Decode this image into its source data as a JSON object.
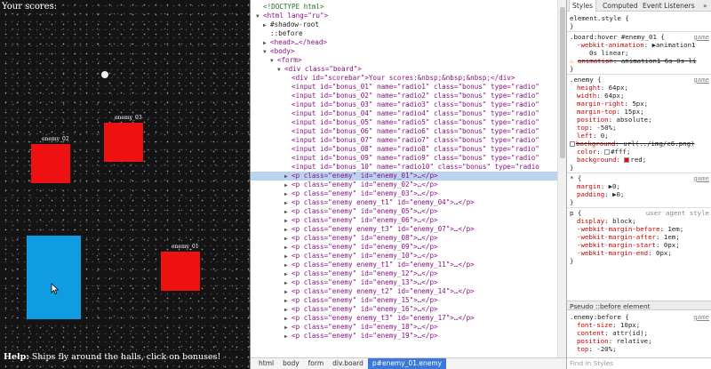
{
  "game": {
    "scorebar": "Your scores:",
    "help_label": "Help:",
    "help_text": " Ships fly around the halls, click on bonuses!",
    "enemies": [
      {
        "id": "enemy_03",
        "label": "enemy_03",
        "color": "#ee1111"
      },
      {
        "id": "enemy_02",
        "label": "enemy_02",
        "color": "#ee1111"
      },
      {
        "id": "enemy_01",
        "label": "enemy_01",
        "color": "#ee1111"
      }
    ],
    "player_color": "#109ce0"
  },
  "elements": {
    "lines": [
      {
        "indent": 0,
        "arrow": "",
        "text": "<!DOCTYPE html>",
        "kind": "comment"
      },
      {
        "indent": 0,
        "arrow": "▼",
        "text": "<html lang=\"ru\">",
        "kind": "tag"
      },
      {
        "indent": 1,
        "arrow": "▶",
        "text": "#shadow-root",
        "kind": "text"
      },
      {
        "indent": 1,
        "arrow": "",
        "text": "::before",
        "kind": "pseudo"
      },
      {
        "indent": 1,
        "arrow": "▶",
        "text": "<head>…</head>",
        "kind": "tag"
      },
      {
        "indent": 1,
        "arrow": "▼",
        "text": "<body>",
        "kind": "tag"
      },
      {
        "indent": 2,
        "arrow": "▼",
        "text": "<form>",
        "kind": "tag"
      },
      {
        "indent": 3,
        "arrow": "▼",
        "text": "<div class=\"board\">",
        "kind": "tag"
      },
      {
        "indent": 4,
        "arrow": "",
        "text": "<div id=\"scorebar\">Your scores:&nbsp;&nbsp;&nbsp;</div>",
        "kind": "tag"
      },
      {
        "indent": 4,
        "arrow": "",
        "text": "<input id=\"bonus_01\" name=\"radio1\" class=\"bonus\" type=\"radio\"",
        "kind": "tag"
      },
      {
        "indent": 4,
        "arrow": "",
        "text": "<input id=\"bonus_02\" name=\"radio2\" class=\"bonus\" type=\"radio\"",
        "kind": "tag"
      },
      {
        "indent": 4,
        "arrow": "",
        "text": "<input id=\"bonus_03\" name=\"radio3\" class=\"bonus\" type=\"radio\"",
        "kind": "tag"
      },
      {
        "indent": 4,
        "arrow": "",
        "text": "<input id=\"bonus_04\" name=\"radio4\" class=\"bonus\" type=\"radio\"",
        "kind": "tag"
      },
      {
        "indent": 4,
        "arrow": "",
        "text": "<input id=\"bonus_05\" name=\"radio5\" class=\"bonus\" type=\"radio\"",
        "kind": "tag"
      },
      {
        "indent": 4,
        "arrow": "",
        "text": "<input id=\"bonus_06\" name=\"radio6\" class=\"bonus\" type=\"radio\"",
        "kind": "tag"
      },
      {
        "indent": 4,
        "arrow": "",
        "text": "<input id=\"bonus_07\" name=\"radio7\" class=\"bonus\" type=\"radio\"",
        "kind": "tag"
      },
      {
        "indent": 4,
        "arrow": "",
        "text": "<input id=\"bonus_08\" name=\"radio8\" class=\"bonus\" type=\"radio\"",
        "kind": "tag"
      },
      {
        "indent": 4,
        "arrow": "",
        "text": "<input id=\"bonus_09\" name=\"radio9\" class=\"bonus\" type=\"radio\"",
        "kind": "tag"
      },
      {
        "indent": 4,
        "arrow": "",
        "text": "<input id=\"bonus_10\" name=\"radio10\" class=\"bonus\" type=\"radio",
        "kind": "tag"
      },
      {
        "indent": 4,
        "arrow": "▶",
        "text": "<p class=\"enemy\" id=\"enemy_01\">…</p>",
        "kind": "tag",
        "selected": true
      },
      {
        "indent": 4,
        "arrow": "▶",
        "text": "<p class=\"enemy\" id=\"enemy_02\">…</p>",
        "kind": "tag"
      },
      {
        "indent": 4,
        "arrow": "▶",
        "text": "<p class=\"enemy\" id=\"enemy_03\">…</p>",
        "kind": "tag"
      },
      {
        "indent": 4,
        "arrow": "▶",
        "text": "<p class=\"enemy enemy_t1\" id=\"enemy_04\">…</p>",
        "kind": "tag"
      },
      {
        "indent": 4,
        "arrow": "▶",
        "text": "<p class=\"enemy\" id=\"enemy_05\">…</p>",
        "kind": "tag"
      },
      {
        "indent": 4,
        "arrow": "▶",
        "text": "<p class=\"enemy\" id=\"enemy_06\">…</p>",
        "kind": "tag"
      },
      {
        "indent": 4,
        "arrow": "▶",
        "text": "<p class=\"enemy enemy_t3\" id=\"enemy_07\">…</p>",
        "kind": "tag"
      },
      {
        "indent": 4,
        "arrow": "▶",
        "text": "<p class=\"enemy\" id=\"enemy_08\">…</p>",
        "kind": "tag"
      },
      {
        "indent": 4,
        "arrow": "▶",
        "text": "<p class=\"enemy\" id=\"enemy_09\">…</p>",
        "kind": "tag"
      },
      {
        "indent": 4,
        "arrow": "▶",
        "text": "<p class=\"enemy\" id=\"enemy_10\">…</p>",
        "kind": "tag"
      },
      {
        "indent": 4,
        "arrow": "▶",
        "text": "<p class=\"enemy enemy_t1\" id=\"enemy_11\">…</p>",
        "kind": "tag"
      },
      {
        "indent": 4,
        "arrow": "▶",
        "text": "<p class=\"enemy\" id=\"enemy_12\">…</p>",
        "kind": "tag"
      },
      {
        "indent": 4,
        "arrow": "▶",
        "text": "<p class=\"enemy\" id=\"enemy_13\">…</p>",
        "kind": "tag"
      },
      {
        "indent": 4,
        "arrow": "▶",
        "text": "<p class=\"enemy enemy_t2\" id=\"enemy_14\">…</p>",
        "kind": "tag"
      },
      {
        "indent": 4,
        "arrow": "▶",
        "text": "<p class=\"enemy\" id=\"enemy_15\">…</p>",
        "kind": "tag"
      },
      {
        "indent": 4,
        "arrow": "▶",
        "text": "<p class=\"enemy\" id=\"enemy_16\">…</p>",
        "kind": "tag"
      },
      {
        "indent": 4,
        "arrow": "▶",
        "text": "<p class=\"enemy enemy_t3\" id=\"enemy_17\">…</p>",
        "kind": "tag"
      },
      {
        "indent": 4,
        "arrow": "▶",
        "text": "<p class=\"enemy\" id=\"enemy_18\">…</p>",
        "kind": "tag"
      },
      {
        "indent": 4,
        "arrow": "▶",
        "text": "<p class=\"enemy\" id=\"enemy_19\">…</p>",
        "kind": "tag"
      }
    ],
    "breadcrumbs": [
      "html",
      "body",
      "form",
      "div.board",
      "p#enemy_01.enemy"
    ],
    "selected_crumb": 4
  },
  "styles": {
    "tabs": [
      "Styles",
      "Computed",
      "Event Listeners",
      "»"
    ],
    "rules": [
      {
        "kind": "selector",
        "text": "element.style {"
      },
      {
        "kind": "close",
        "text": "}"
      },
      {
        "kind": "sep"
      },
      {
        "kind": "selector",
        "text": ".board:hover #enemy_01 {",
        "source": "game"
      },
      {
        "kind": "prop",
        "name": "-webkit-animation",
        "value": "▶animation1",
        "strike": false
      },
      {
        "kind": "cont",
        "text": "0s linear;"
      },
      {
        "kind": "prop",
        "name": "animation",
        "value": "animation1 6s 0s li",
        "strike": true,
        "warn": true
      },
      {
        "kind": "close",
        "text": "}"
      },
      {
        "kind": "sep"
      },
      {
        "kind": "selector",
        "text": ".enemy {",
        "source": "game"
      },
      {
        "kind": "prop",
        "name": "height",
        "value": "64px;"
      },
      {
        "kind": "prop",
        "name": "width",
        "value": "64px;"
      },
      {
        "kind": "prop",
        "name": "margin-right",
        "value": "5px;"
      },
      {
        "kind": "prop",
        "name": "margin-top",
        "value": "15px;"
      },
      {
        "kind": "prop",
        "name": "position",
        "value": "absolute;"
      },
      {
        "kind": "prop",
        "name": "top",
        "value": "-50%;"
      },
      {
        "kind": "prop",
        "name": "left",
        "value": "0;"
      },
      {
        "kind": "prop",
        "name": "background",
        "value": "url(../img/c6.png)",
        "strike": true,
        "check": true
      },
      {
        "kind": "prop",
        "name": "color",
        "value": "#fff;",
        "swatch": "#ffffff"
      },
      {
        "kind": "prop",
        "name": "background",
        "value": "red;",
        "swatch": "#ff0000"
      },
      {
        "kind": "close",
        "text": "}"
      },
      {
        "kind": "sep"
      },
      {
        "kind": "selector",
        "text": "* {",
        "source": "game"
      },
      {
        "kind": "prop",
        "name": "margin",
        "value": "▶0;"
      },
      {
        "kind": "prop",
        "name": "padding",
        "value": "▶0;"
      },
      {
        "kind": "close",
        "text": "}"
      },
      {
        "kind": "sep"
      },
      {
        "kind": "selector",
        "text": "p {",
        "source": "user agent style"
      },
      {
        "kind": "prop",
        "name": "display",
        "value": "block;"
      },
      {
        "kind": "prop",
        "name": "-webkit-margin-before",
        "value": "1em;"
      },
      {
        "kind": "prop",
        "name": "-webkit-margin-after",
        "value": "1em;"
      },
      {
        "kind": "prop",
        "name": "-webkit-margin-start",
        "value": "0px;"
      },
      {
        "kind": "prop",
        "name": "-webkit-margin-end",
        "value": "0px;"
      },
      {
        "kind": "close",
        "text": "}"
      }
    ],
    "pseudo_header": "Pseudo ::before element",
    "pseudo_rules": [
      {
        "kind": "selector",
        "text": ".enemy:before {",
        "source": "game"
      },
      {
        "kind": "prop",
        "name": "font-size",
        "value": "10px;"
      },
      {
        "kind": "prop",
        "name": "content",
        "value": "attr(id);"
      },
      {
        "kind": "prop",
        "name": "position",
        "value": "relative;"
      },
      {
        "kind": "prop",
        "name": "top",
        "value": "-20%;"
      }
    ],
    "find_placeholder": "Find in Styles"
  }
}
